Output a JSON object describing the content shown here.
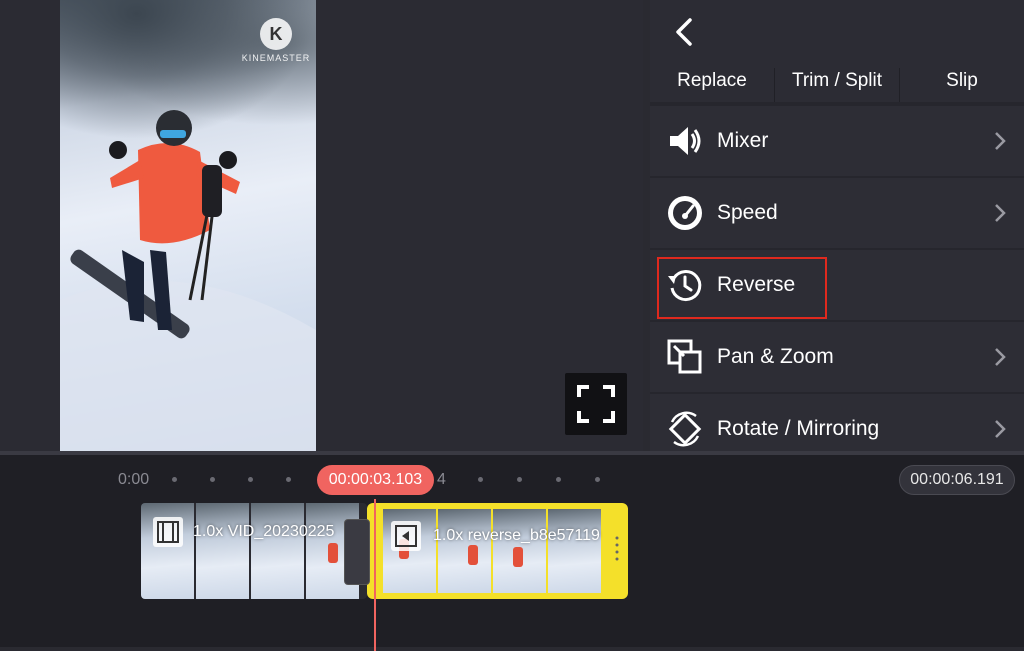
{
  "preview": {
    "watermark_letter": "K",
    "watermark_text": "KINEMASTER"
  },
  "panel": {
    "tabs": [
      "Replace",
      "Trim / Split",
      "Slip"
    ],
    "items": [
      {
        "label": "Mixer",
        "icon": "speaker-icon"
      },
      {
        "label": "Speed",
        "icon": "speedometer-icon"
      },
      {
        "label": "Reverse",
        "icon": "reverse-clock-icon"
      },
      {
        "label": "Pan & Zoom",
        "icon": "pan-zoom-icon"
      },
      {
        "label": "Rotate / Mirroring",
        "icon": "rotate-icon"
      }
    ]
  },
  "timeline": {
    "ruler_start": "0:00",
    "ruler_mark": "4",
    "playhead_time": "00:00:03.103",
    "total_time": "00:00:06.191",
    "clips": [
      {
        "title": "1.0x VID_20230225"
      },
      {
        "title": "1.0x reverse_b8e57119"
      }
    ]
  },
  "colors": {
    "selected_clip": "#f4e02a",
    "playhead": "#f06460",
    "highlight_box": "#e0291e"
  }
}
